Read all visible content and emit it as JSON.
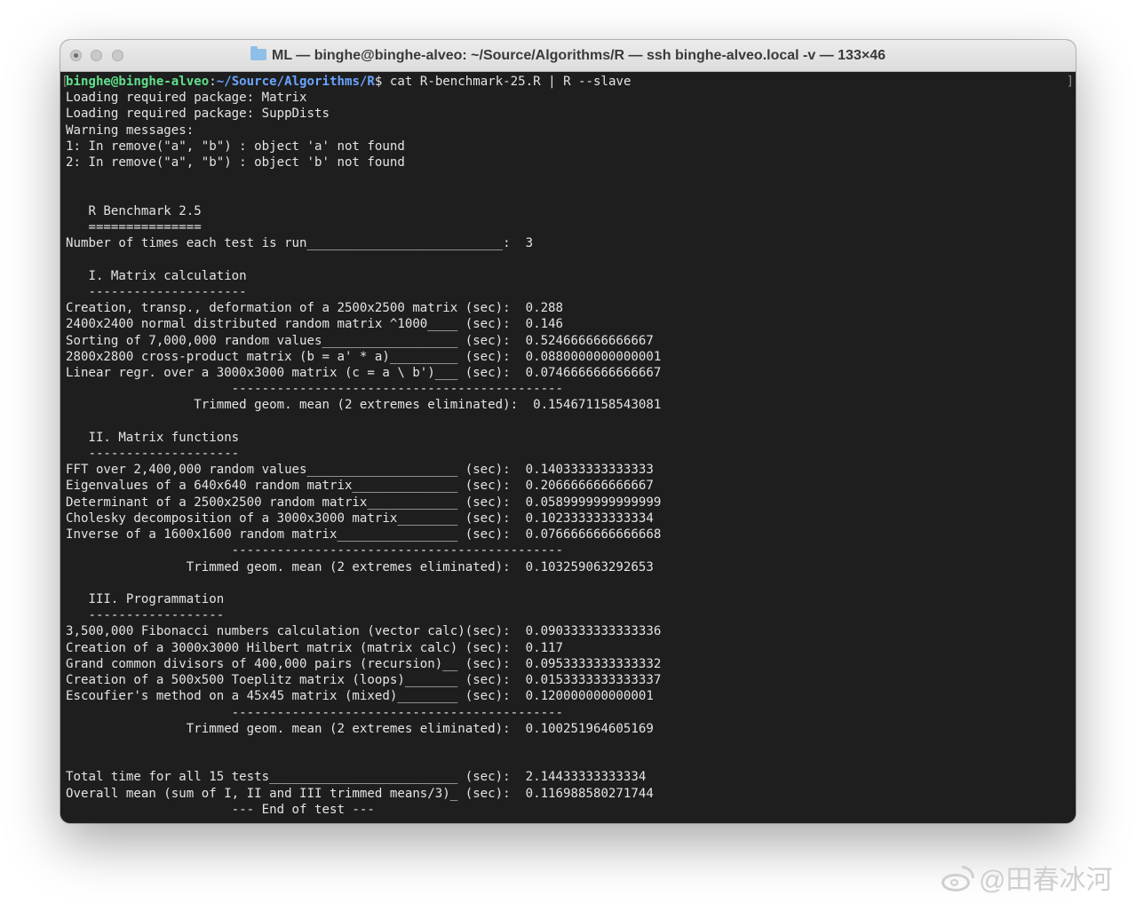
{
  "window": {
    "title": "ML — binghe@binghe-alveo: ~/Source/Algorithms/R — ssh binghe-alveo.local -v — 133×46"
  },
  "terminal": {
    "prompt_user": "binghe@binghe-alveo",
    "prompt_sep": ":",
    "prompt_path": "~/Source/Algorithms/R",
    "prompt_symbol": "$",
    "command": " cat R-benchmark-25.R | R --slave",
    "output": "Loading required package: Matrix\nLoading required package: SuppDists\nWarning messages:\n1: In remove(\"a\", \"b\") : object 'a' not found\n2: In remove(\"a\", \"b\") : object 'b' not found\n\n\n   R Benchmark 2.5\n   ===============\nNumber of times each test is run__________________________:  3\n\n   I. Matrix calculation\n   ---------------------\nCreation, transp., deformation of a 2500x2500 matrix (sec):  0.288\n2400x2400 normal distributed random matrix ^1000____ (sec):  0.146\nSorting of 7,000,000 random values__________________ (sec):  0.524666666666667\n2800x2800 cross-product matrix (b = a' * a)_________ (sec):  0.0880000000000001\nLinear regr. over a 3000x3000 matrix (c = a \\ b')___ (sec):  0.0746666666666667\n                      --------------------------------------------\n                 Trimmed geom. mean (2 extremes eliminated):  0.154671158543081\n\n   II. Matrix functions\n   --------------------\nFFT over 2,400,000 random values____________________ (sec):  0.140333333333333\nEigenvalues of a 640x640 random matrix______________ (sec):  0.206666666666667\nDeterminant of a 2500x2500 random matrix____________ (sec):  0.0589999999999999\nCholesky decomposition of a 3000x3000 matrix________ (sec):  0.102333333333334\nInverse of a 1600x1600 random matrix________________ (sec):  0.0766666666666668\n                      --------------------------------------------\n                Trimmed geom. mean (2 extremes eliminated):  0.103259063292653\n\n   III. Programmation\n   ------------------\n3,500,000 Fibonacci numbers calculation (vector calc)(sec):  0.0903333333333336\nCreation of a 3000x3000 Hilbert matrix (matrix calc) (sec):  0.117\nGrand common divisors of 400,000 pairs (recursion)__ (sec):  0.0953333333333332\nCreation of a 500x500 Toeplitz matrix (loops)_______ (sec):  0.0153333333333337\nEscoufier's method on a 45x45 matrix (mixed)________ (sec):  0.120000000000001\n                      --------------------------------------------\n                Trimmed geom. mean (2 extremes eliminated):  0.100251964605169\n\n\nTotal time for all 15 tests_________________________ (sec):  2.14433333333334\nOverall mean (sum of I, II and III trimmed means/3)_ (sec):  0.116988580271744\n                      --- End of test ---"
  },
  "watermark": {
    "text": "@田春冰河"
  },
  "colors": {
    "background": "#1e1e1e",
    "text": "#e4e4e4",
    "prompt_user": "#5fe08a",
    "prompt_path": "#6aa4ff"
  }
}
